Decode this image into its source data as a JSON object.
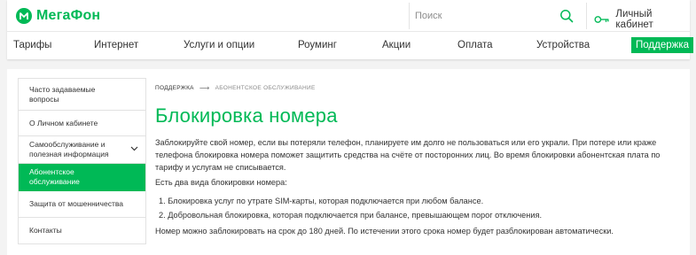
{
  "header": {
    "logo_text": "МегаФон",
    "search_placeholder": "Поиск",
    "cabinet_label": "Личный кабинет"
  },
  "nav": {
    "items": [
      {
        "label": "Тарифы"
      },
      {
        "label": "Интернет"
      },
      {
        "label": "Услуги и опции"
      },
      {
        "label": "Роуминг"
      },
      {
        "label": "Акции"
      },
      {
        "label": "Оплата"
      },
      {
        "label": "Устройства"
      },
      {
        "label": "Поддержка",
        "active": true
      }
    ]
  },
  "sidebar": {
    "items": [
      {
        "label": "Часто задаваемые вопросы"
      },
      {
        "label": "О Личном кабинете"
      },
      {
        "label": "Самообслуживание и полезная информация",
        "expandable": true
      },
      {
        "label": "Абонентское обслуживание",
        "active": true
      },
      {
        "label": "Защита от мошенничества"
      },
      {
        "label": "Контакты"
      }
    ]
  },
  "breadcrumb": {
    "parent": "ПОДДЕРЖКА",
    "arrow": "⟶",
    "current": "АБОНЕНТСКОЕ ОБСЛУЖИВАНИЕ"
  },
  "content": {
    "title": "Блокировка номера",
    "intro": "Заблокируйте свой номер, если вы потеряли телефон, планируете им долго не пользоваться или его украли. При потере или краже телефона блокировка номера поможет защитить средства на счёте от посторонних лиц. Во время блокировки абонентская плата по тарифу и услугам не списывается.",
    "types_heading": "Есть два вида блокировки номера:",
    "types": [
      "1. Блокировка услуг по утрате SIM-карты, которая подключается при любом балансе.",
      "2. Добровольная блокировка, которая подключается при балансе, превышающем порог отключения."
    ],
    "term_note": "Номер можно заблокировать на срок до 180 дней. По истечении этого срока номер будет разблокирован автоматически."
  },
  "colors": {
    "brand_green": "#00b956",
    "background": "#f3f3f3",
    "text": "#333333"
  }
}
